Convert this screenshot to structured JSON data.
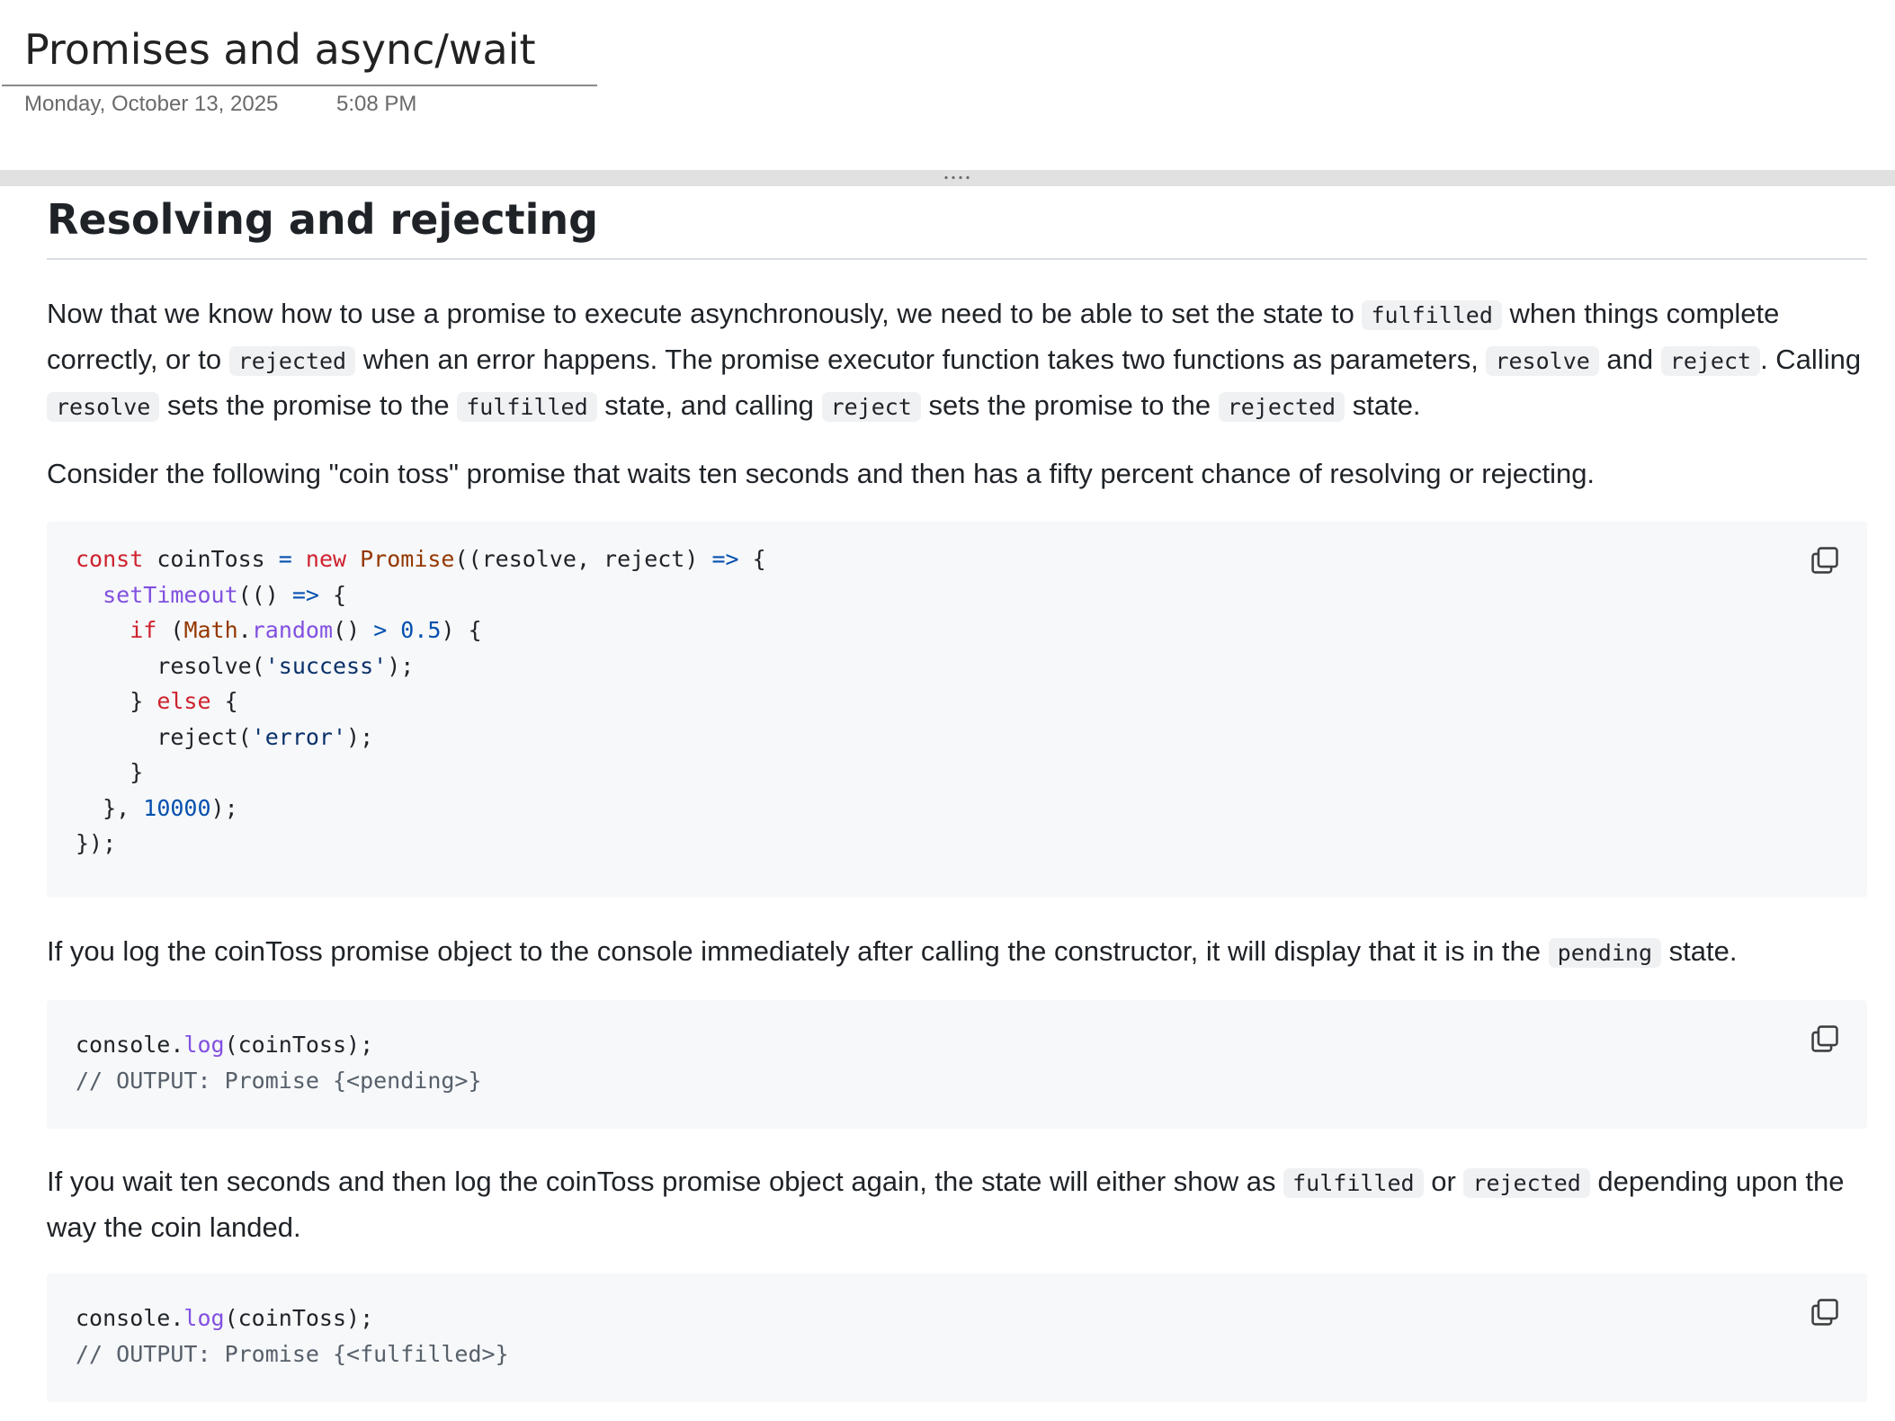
{
  "note": {
    "title": "Promises and async/wait",
    "date": "Monday, October 13, 2025",
    "time": "5:08 PM"
  },
  "section": {
    "heading": "Resolving and rejecting"
  },
  "para1": {
    "t1": "Now that we know how to use a promise to execute asynchronously, we need to be able to set the state to ",
    "c1": "fulfilled",
    "t2": " when things complete correctly, or to ",
    "c2": "rejected",
    "t3": " when an error happens. The promise executor function takes two functions as parameters, ",
    "c3": "resolve",
    "t4": " and ",
    "c4": "reject",
    "t5": ". Calling ",
    "c5": "resolve",
    "t6": " sets the promise to the ",
    "c6": "fulfilled",
    "t7": " state, and calling ",
    "c7": "reject",
    "t8": " sets the promise to the ",
    "c8": "rejected",
    "t9": " state."
  },
  "para2": {
    "text": "Consider the following \"coin toss\" promise that waits ten seconds and then has a fifty percent chance of resolving or rejecting."
  },
  "code1": {
    "l1_const": "const",
    "l1_name": " coinToss ",
    "l1_eq": "=",
    "l1_new": " new",
    "l1_promise": " Promise",
    "l1_params": "((resolve, reject) ",
    "l1_arrow": "=>",
    "l1_brace": " {",
    "l2_indent": "  ",
    "l2_settimeout": "setTimeout",
    "l2_paren": "(() ",
    "l2_arrow": "=>",
    "l2_brace": " {",
    "l3_indent": "    ",
    "l3_if": "if",
    "l3_open": " (",
    "l3_math": "Math",
    "l3_dot": ".",
    "l3_random": "random",
    "l3_call": "() ",
    "l3_gt": ">",
    "l3_num": " 0.5",
    "l3_close": ") {",
    "l4_pre": "      resolve(",
    "l4_str": "'success'",
    "l4_post": ");",
    "l5_close": "    } ",
    "l5_else": "else",
    "l5_brace": " {",
    "l6_pre": "      reject(",
    "l6_str": "'error'",
    "l6_post": ");",
    "l7": "    }",
    "l8_pre": "  }, ",
    "l8_num": "10000",
    "l8_post": ");",
    "l9": "});"
  },
  "para3": {
    "t1": "If you log the coinToss promise object to the console immediately after calling the constructor, it will display that it is in the ",
    "c1": "pending",
    "t2": " state."
  },
  "code2": {
    "obj": "console",
    "dot": ".",
    "fn": "log",
    "args": "(coinToss);",
    "comment": "// OUTPUT: Promise {<pending>}"
  },
  "para4": {
    "t1": "If you wait ten seconds and then log the coinToss promise object again, the state will either show as ",
    "c1": "fulfilled",
    "t2": " or ",
    "c2": "rejected",
    "t3": " depending upon the way the coin landed."
  },
  "code3": {
    "obj": "console",
    "dot": ".",
    "fn": "log",
    "args": "(coinToss);",
    "comment": "// OUTPUT: Promise {<fulfilled>}"
  },
  "icons": {
    "copy": "copy-icon",
    "grip": "drag-handle-icon"
  }
}
